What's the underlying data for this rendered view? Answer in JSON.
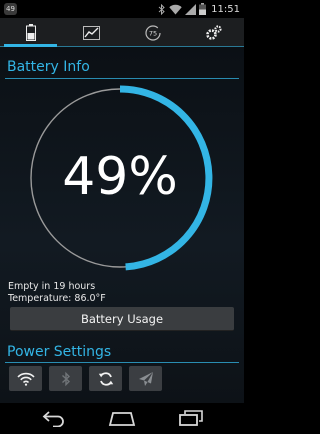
{
  "status_bar": {
    "notification_count": "49",
    "time": "11:51",
    "icons": [
      "notification-badge",
      "bluetooth-icon",
      "wifi-icon",
      "signal-icon",
      "battery-icon"
    ]
  },
  "tabs": [
    {
      "icon": "battery-icon",
      "active": true
    },
    {
      "icon": "chart-icon",
      "active": false
    },
    {
      "icon": "history-icon",
      "label": "75",
      "active": false
    },
    {
      "icon": "gear-icon",
      "active": false
    }
  ],
  "battery_info": {
    "title": "Battery Info",
    "level_percent": 49,
    "level_label": "49%",
    "empty_estimate": "Empty in 19 hours",
    "temperature": "Temperature: 86.0°F",
    "usage_button": "Battery Usage"
  },
  "power_settings": {
    "title": "Power Settings",
    "toggles": [
      {
        "icon": "wifi-icon",
        "enabled": true
      },
      {
        "icon": "bluetooth-icon",
        "enabled": false
      },
      {
        "icon": "sync-icon",
        "enabled": true
      },
      {
        "icon": "airplane-icon",
        "enabled": false
      }
    ]
  },
  "colors": {
    "accent": "#33b5e5",
    "ring": "#9a9a9a",
    "button": "#3a3d40"
  },
  "nav": [
    "back-icon",
    "home-icon",
    "recent-apps-icon"
  ]
}
